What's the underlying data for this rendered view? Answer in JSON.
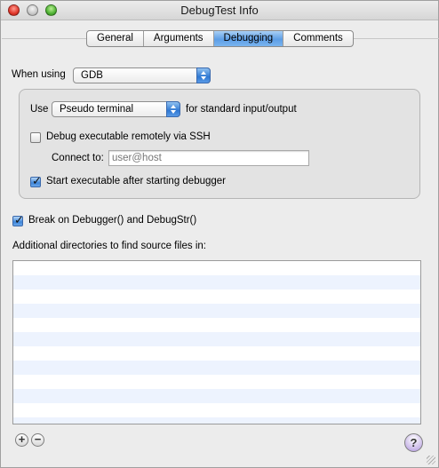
{
  "window": {
    "title": "DebugTest Info"
  },
  "tabs": [
    {
      "label": "General"
    },
    {
      "label": "Arguments"
    },
    {
      "label": "Debugging",
      "active": true
    },
    {
      "label": "Comments"
    }
  ],
  "debugger": {
    "when_using_label": "When using",
    "selected": "GDB"
  },
  "group": {
    "use_label": "Use",
    "terminal_selected": "Pseudo terminal",
    "for_standard_label": "for standard input/output",
    "remote_ssh_label": "Debug executable remotely via SSH",
    "remote_ssh_checked": false,
    "connect_to_label": "Connect to:",
    "connect_to_placeholder": "user@host",
    "start_after_label": "Start executable after starting debugger",
    "start_after_checked": true
  },
  "break_on_label": "Break on Debugger() and DebugStr()",
  "break_on_checked": true,
  "source_dirs_label": "Additional directories to find source files in:",
  "source_dirs": [],
  "buttons": {
    "add": "+",
    "remove": "−",
    "help": "?"
  },
  "colors": {
    "accent": "#3f86d9",
    "list_stripe": "#edf3fe"
  }
}
